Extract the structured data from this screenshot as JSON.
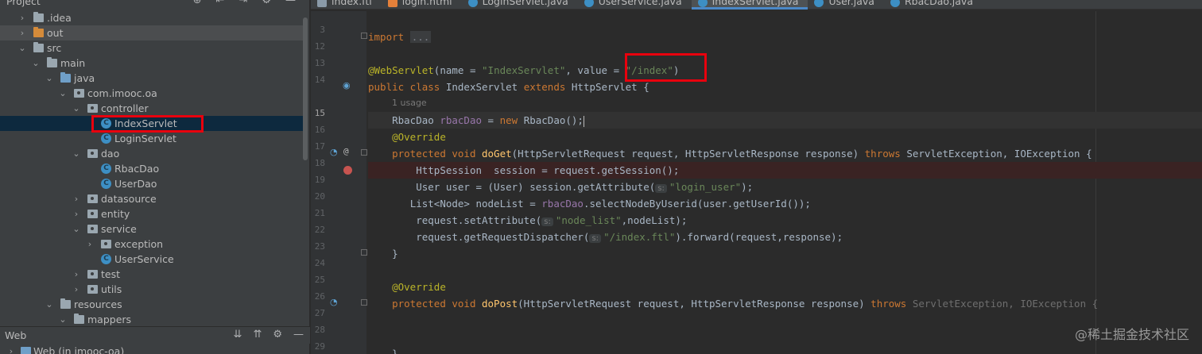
{
  "project_panel": {
    "title": "Project",
    "tree": [
      {
        "label": ".idea",
        "arrow": "›",
        "icon": "folder",
        "depth": 0
      },
      {
        "label": "out",
        "arrow": "›",
        "icon": "folder-orange",
        "depth": 0,
        "state": "hover"
      },
      {
        "label": "src",
        "arrow": "⌄",
        "icon": "folder",
        "depth": 0
      },
      {
        "label": "main",
        "arrow": "⌄",
        "icon": "folder",
        "depth": 1
      },
      {
        "label": "java",
        "arrow": "⌄",
        "icon": "folder-blue",
        "depth": 2
      },
      {
        "label": "com.imooc.oa",
        "arrow": "⌄",
        "icon": "package",
        "depth": 3
      },
      {
        "label": "controller",
        "arrow": "⌄",
        "icon": "package",
        "depth": 4
      },
      {
        "label": "IndexServlet",
        "arrow": "",
        "icon": "class",
        "depth": 5,
        "state": "selected"
      },
      {
        "label": "LoginServlet",
        "arrow": "",
        "icon": "class",
        "depth": 5
      },
      {
        "label": "dao",
        "arrow": "⌄",
        "icon": "package",
        "depth": 4
      },
      {
        "label": "RbacDao",
        "arrow": "",
        "icon": "class",
        "depth": 5
      },
      {
        "label": "UserDao",
        "arrow": "",
        "icon": "class",
        "depth": 5
      },
      {
        "label": "datasource",
        "arrow": "›",
        "icon": "package",
        "depth": 4
      },
      {
        "label": "entity",
        "arrow": "›",
        "icon": "package",
        "depth": 4
      },
      {
        "label": "service",
        "arrow": "⌄",
        "icon": "package",
        "depth": 4
      },
      {
        "label": "exception",
        "arrow": "›",
        "icon": "package",
        "depth": 5
      },
      {
        "label": "UserService",
        "arrow": "",
        "icon": "class",
        "depth": 5
      },
      {
        "label": "test",
        "arrow": "›",
        "icon": "package",
        "depth": 4
      },
      {
        "label": "utils",
        "arrow": "›",
        "icon": "package",
        "depth": 4
      },
      {
        "label": "resources",
        "arrow": "⌄",
        "icon": "folder",
        "depth": 2
      },
      {
        "label": "mappers",
        "arrow": "⌄",
        "icon": "folder",
        "depth": 3
      }
    ]
  },
  "web_panel": {
    "title": "Web",
    "row_label": "Web (in imooc-oa)"
  },
  "tabs": [
    {
      "label": "index.ftl",
      "icon": "ftl"
    },
    {
      "label": "login.html",
      "icon": "html"
    },
    {
      "label": "LoginServlet.java",
      "icon": "class"
    },
    {
      "label": "UserService.java",
      "icon": "class"
    },
    {
      "label": "IndexServlet.java",
      "icon": "class",
      "active": true
    },
    {
      "label": "User.java",
      "icon": "class"
    },
    {
      "label": "RbacDao.java",
      "icon": "class"
    }
  ],
  "editor": {
    "line_numbers": [
      "3",
      "12",
      "13",
      "14",
      "15",
      "16",
      "17",
      "18",
      "19",
      "20",
      "21",
      "22",
      "23",
      "24",
      "25",
      "26",
      "27",
      "28",
      "29"
    ],
    "usage_hint": "1 usage",
    "code": {
      "import_kw": "import",
      "import_fold": "...",
      "ws_annotation": "@WebServlet",
      "ws_args_a": "(name = ",
      "ws_name": "\"IndexServlet\"",
      "ws_args_b": ", value = ",
      "ws_value": "\"/index\"",
      "ws_close": ")",
      "public_class": "public class ",
      "class_name": "IndexServlet ",
      "extends": "extends ",
      "parent": "HttpServlet {",
      "l15_type": "RbacDao ",
      "l15_field": "rbacDao",
      "l15_eq": " = ",
      "l15_new": "new ",
      "l15_rest": "RbacDao();",
      "override": "@Override",
      "protected_void": "protected void ",
      "doget": "doGet",
      "doget_params": "(HttpServletRequest request, HttpServletResponse response) ",
      "throws": "throws ",
      "exceptions": "ServletException, IOException {",
      "l18": "HttpSession  session = request.getSession();",
      "l19_a": "User user = (User) session.getAttribute(",
      "hint_s": "s:",
      "l19_str": "\"login_user\"",
      "l19_b": ");",
      "l20_a": "List<Node> nodeList = ",
      "l20_field": "rbacDao",
      "l20_b": ".selectNodeByUserid(user.getUserId());",
      "l21_a": "request.setAttribute(",
      "l21_str": "\"node_list\"",
      "l21_b": ",nodeList);",
      "l22_a": "request.getRequestDispatcher(",
      "l22_str": "\"/index.ftl\"",
      "l22_b": ").forward(request,response);",
      "close_brace": "}",
      "dopost": "doPost",
      "dopost_params": "(HttpServletRequest request, HttpServletResponse response) ",
      "dopost_exceptions": "ServletException, IOException {",
      "l29": "}"
    }
  },
  "watermark": "@稀土掘金技术社区",
  "colors": {
    "highlight_box": "#e8000d",
    "keyword": "#cc7832",
    "annotation": "#bbb529",
    "string": "#6a8759",
    "function": "#ffc66d",
    "field": "#9876aa"
  }
}
